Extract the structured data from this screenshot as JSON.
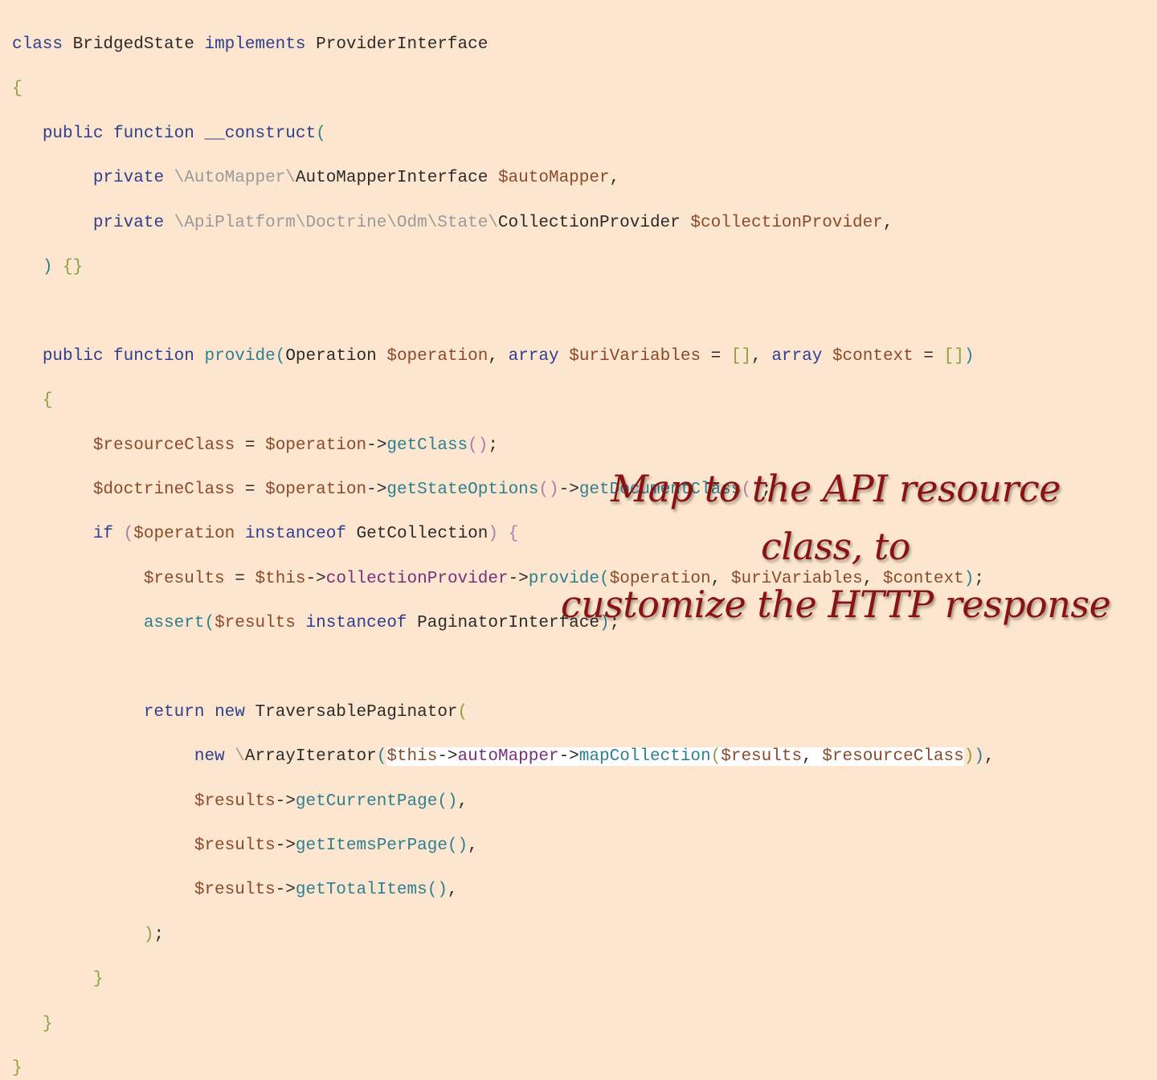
{
  "code": {
    "l01": [
      "class",
      "BridgedState",
      "implements",
      "ProviderInterface"
    ],
    "l02": [
      "{"
    ],
    "l03": [
      "public",
      "function",
      "__construct",
      "("
    ],
    "l04": [
      "private",
      "\\AutoMapper\\",
      "AutoMapperInterface",
      "$autoMapper",
      ","
    ],
    "l05": [
      "private",
      "\\ApiPlatform\\Doctrine\\Odm\\State\\",
      "CollectionProvider",
      "$collectionProvider",
      ","
    ],
    "l06": [
      ")",
      "{}"
    ],
    "l07": [
      "public",
      "function",
      "provide",
      "(",
      "Operation",
      "$operation",
      ",",
      "array",
      "$uriVariables",
      "=",
      "[]",
      ",",
      "array",
      "$context",
      "=",
      "[]",
      ")"
    ],
    "l08": [
      "{"
    ],
    "l09": [
      "$resourceClass",
      "=",
      "$operation",
      "->",
      "getClass",
      "()",
      ";"
    ],
    "l10": [
      "$doctrineClass",
      "=",
      "$operation",
      "->",
      "getStateOptions",
      "()",
      "->",
      "getDocumentClass",
      "()",
      ";"
    ],
    "l11": [
      "if",
      "(",
      "$operation",
      "instanceof",
      "GetCollection",
      ")",
      "{"
    ],
    "l12": [
      "$results",
      "=",
      "$this",
      "->",
      "collectionProvider",
      "->",
      "provide",
      "(",
      "$operation",
      ",",
      "$uriVariables",
      ",",
      "$context",
      ")",
      ";"
    ],
    "l13": [
      "assert",
      "(",
      "$results",
      "instanceof",
      "PaginatorInterface",
      ")",
      ";"
    ],
    "l14": [
      "return",
      "new",
      "TraversablePaginator",
      "("
    ],
    "l15": [
      "new",
      "\\",
      "ArrayIterator",
      "(",
      "$this",
      "->",
      "autoMapper",
      "->",
      "mapCollection",
      "(",
      "$results",
      ",",
      "$resourceClass",
      ")",
      ")",
      ","
    ],
    "l16": [
      "$results",
      "->",
      "getCurrentPage",
      "()",
      ","
    ],
    "l17": [
      "$results",
      "->",
      "getItemsPerPage",
      "()",
      ","
    ],
    "l18": [
      "$results",
      "->",
      "getTotalItems",
      "()",
      ","
    ],
    "l19": [
      ")",
      ";"
    ],
    "l20": [
      "}"
    ],
    "l21": [
      "}"
    ],
    "l22": [
      "}"
    ]
  },
  "annotation": {
    "line1": "Map to the API resource class, to",
    "line2": "customize the HTTP response"
  },
  "colors": {
    "background": "#fce6cf",
    "keyword": "#2f3f8f",
    "function": "#2e7f8f",
    "variable": "#8b4a2a",
    "property": "#7a2f7a",
    "annotation": "#8b1212"
  }
}
